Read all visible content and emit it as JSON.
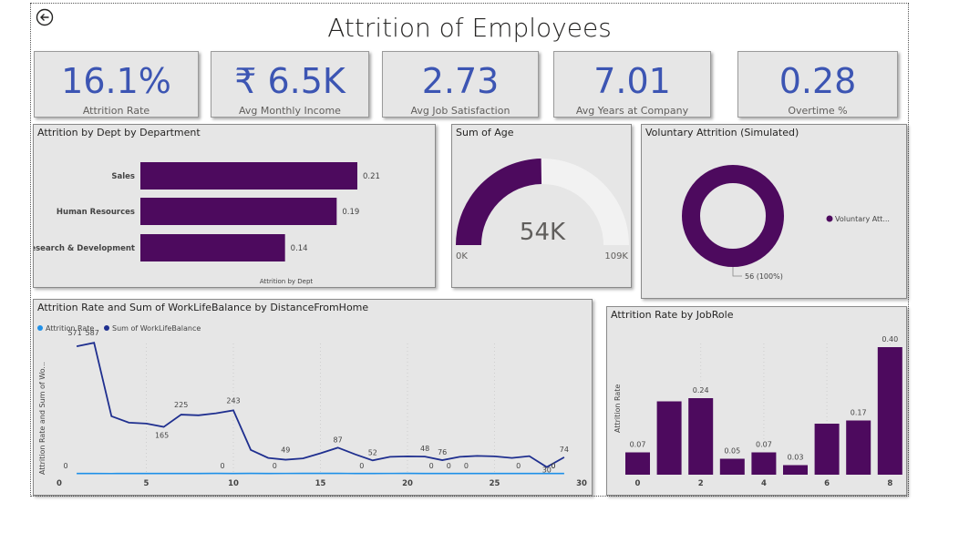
{
  "page": {
    "title": "Attrition of Employees",
    "back_icon": "back-arrow-icon"
  },
  "kpis": [
    {
      "value": "16.1%",
      "label": "Attrition Rate"
    },
    {
      "value": "₹ 6.5K",
      "label": "Avg Monthly Income"
    },
    {
      "value": "2.73",
      "label": "Avg Job Satisfaction"
    },
    {
      "value": "7.01",
      "label": "Avg Years at Company"
    },
    {
      "value": "0.28",
      "label": "Overtime %"
    }
  ],
  "colors": {
    "bar": "#4d0a5e",
    "kpi": "#3c55b3",
    "line_dark": "#1f2f8f",
    "line_light": "#1e90e8",
    "gauge_bg": "#f2f2f2"
  },
  "dept": {
    "title": "Attrition by Dept by Department",
    "axis_label": "Attrition by Dept",
    "chart_data": {
      "type": "bar",
      "categories": [
        "Sales",
        "Human Resources",
        "Research & Development"
      ],
      "values": [
        0.21,
        0.19,
        0.14
      ],
      "labels": [
        "0.21",
        "0.19",
        "0.14"
      ]
    }
  },
  "age": {
    "title": "Sum of Age",
    "chart_data": {
      "type": "gauge",
      "value": 54000,
      "min": 0,
      "max": 109000
    },
    "value_label": "54K",
    "min_label": "0K",
    "max_label": "109K"
  },
  "voluntary": {
    "title": "Voluntary Attrition (Simulated)",
    "chart_data": {
      "type": "pie",
      "categories": [
        "Voluntary Att..."
      ],
      "values": [
        56
      ]
    },
    "legend_label": "Voluntary Att...",
    "data_label": "56 (100%)"
  },
  "distance": {
    "title": "Attrition Rate and Sum of WorkLifeBalance by DistanceFromHome",
    "legend": [
      "Attrition Rate",
      "Sum of WorkLifeBalance"
    ],
    "y_label": "Attrition Rate and Sum of Wo...",
    "x_ticks": [
      "0",
      "5",
      "10",
      "15",
      "20",
      "25",
      "30"
    ],
    "chart_data": {
      "type": "line",
      "x": [
        1,
        2,
        3,
        4,
        5,
        6,
        7,
        8,
        9,
        10,
        11,
        12,
        13,
        14,
        15,
        16,
        17,
        18,
        19,
        20,
        21,
        22,
        23,
        24,
        25,
        26,
        27,
        28,
        29
      ],
      "series": [
        {
          "name": "Sum of WorkLifeBalance",
          "values": [
            571,
            587,
            258,
            229,
            225,
            210,
            265,
            262,
            271,
            284,
            107,
            71,
            63,
            69,
            92,
            117,
            87,
            60,
            76,
            78,
            77,
            61,
            76,
            80,
            78,
            71,
            79,
            30,
            74
          ]
        },
        {
          "name": "Attrition Rate",
          "values": [
            0.16,
            0.14,
            0.13,
            0.15,
            0.16,
            0.15,
            0.18,
            0.16,
            0.2,
            0.16,
            0.2,
            0.17,
            0.19,
            0.21,
            0.2,
            0.2,
            0.18,
            0.17,
            0.19,
            0.2,
            0.17,
            0.18,
            0.17,
            0.17,
            0.18,
            0.17,
            0.17,
            0.17,
            0.16
          ]
        }
      ],
      "xlim": [
        0,
        30
      ]
    },
    "labels": [
      {
        "x": 1,
        "text": "571"
      },
      {
        "x": 2,
        "text": "587"
      },
      {
        "x": 6,
        "text": "165"
      },
      {
        "x": 7,
        "text": "225"
      },
      {
        "x": 10,
        "text": "243"
      },
      {
        "x": 13,
        "text": "49"
      },
      {
        "x": 16,
        "text": "87"
      },
      {
        "x": 18,
        "text": "52"
      },
      {
        "x": 21,
        "text": "48"
      },
      {
        "x": 22,
        "text": "76"
      },
      {
        "x": 29,
        "text": "74"
      },
      {
        "x": 28,
        "text": "30"
      }
    ],
    "zero_labels": [
      1,
      10,
      13,
      18,
      22,
      23,
      24,
      27,
      29,
      29
    ]
  },
  "jobrole": {
    "title": "Attrition Rate by JobRole",
    "y_label": "Attrition Rate",
    "x_ticks": [
      "0",
      "2",
      "4",
      "6",
      "8"
    ],
    "chart_data": {
      "type": "bar",
      "x": [
        0,
        1,
        2,
        3,
        4,
        5,
        6,
        7,
        8
      ],
      "values": [
        0.07,
        0.23,
        0.24,
        0.05,
        0.07,
        0.03,
        0.16,
        0.17,
        0.4
      ],
      "labels": [
        "0.07",
        "",
        "0.24",
        "0.05",
        "0.07",
        "0.03",
        "",
        "0.17",
        "0.40"
      ]
    }
  }
}
